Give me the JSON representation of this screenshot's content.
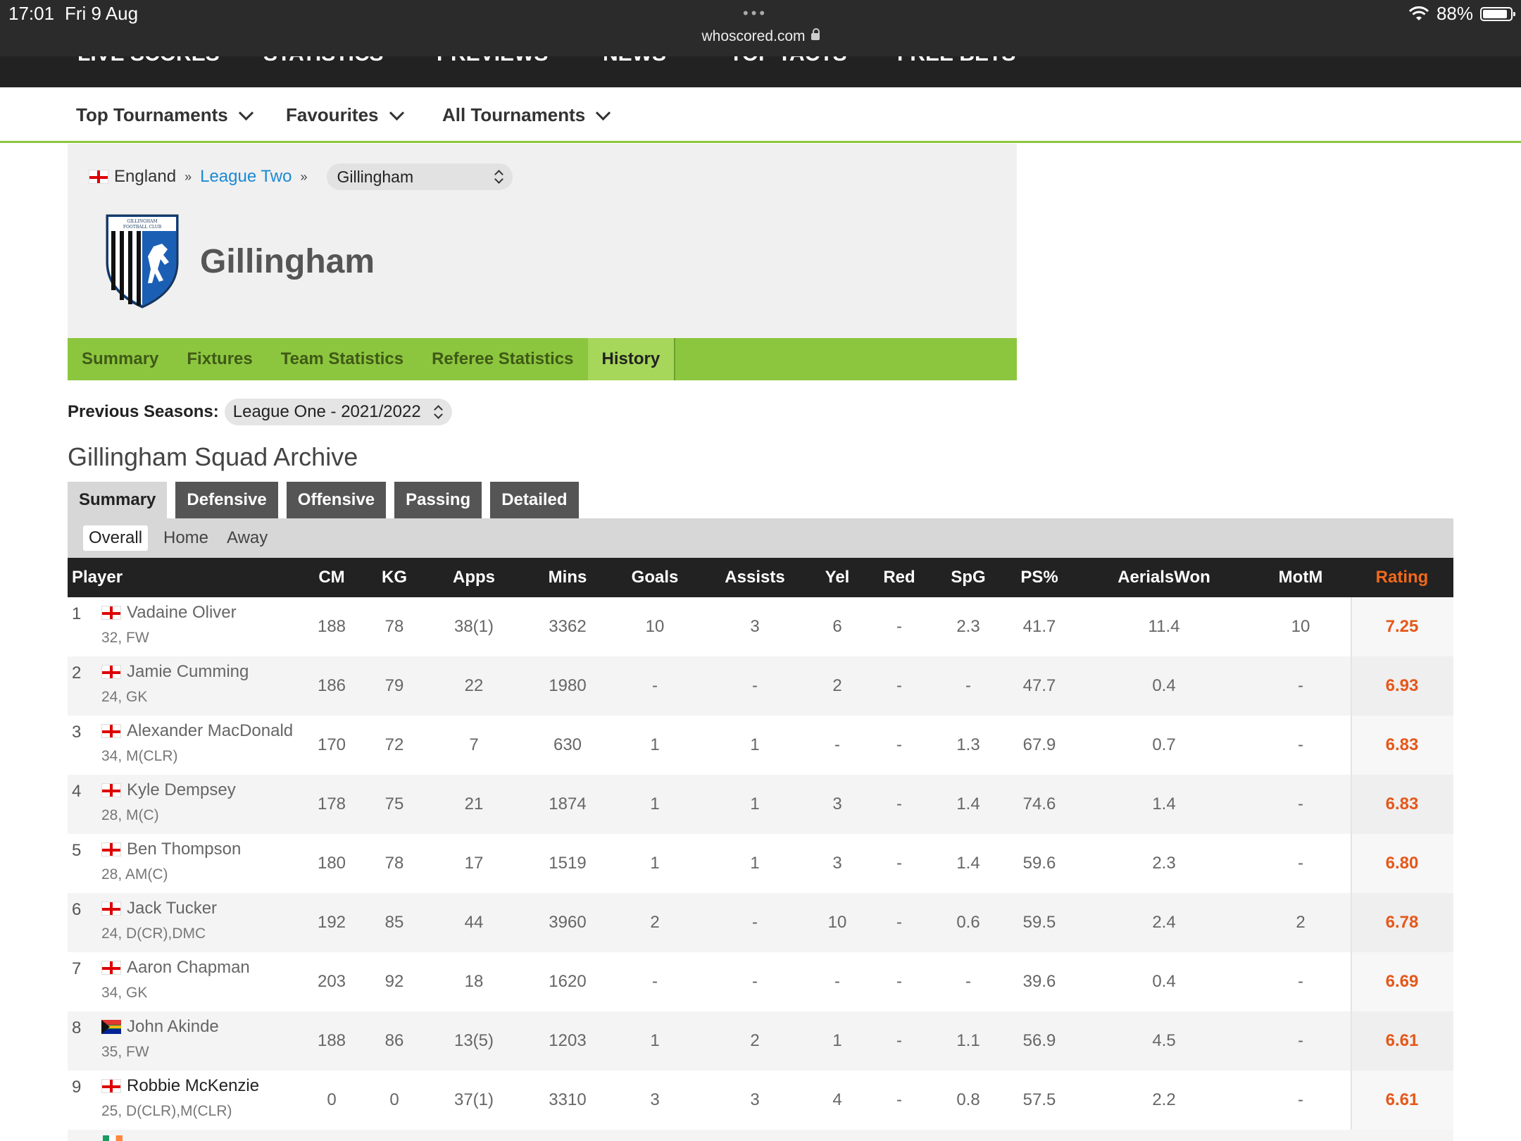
{
  "status_bar": {
    "time": "17:01",
    "date": "Fri 9 Aug",
    "url": "whoscored.com",
    "battery": "88%"
  },
  "site_nav": {
    "items": [
      "LIVE SCORES",
      "STATISTICS",
      "PREVIEWS",
      "NEWS",
      "TOP TACTS",
      "FREE BETS"
    ]
  },
  "tournament_bar": {
    "items": [
      "Top Tournaments",
      "Favourites",
      "All Tournaments"
    ]
  },
  "breadcrumb": {
    "country": "England",
    "league": "League Two",
    "team_select": "Gillingham"
  },
  "team": {
    "name": "Gillingham",
    "crest_text": "GILLINGHAM FOOTBALL CLUB"
  },
  "team_tabs": [
    "Summary",
    "Fixtures",
    "Team Statistics",
    "Referee Statistics",
    "History"
  ],
  "previous_seasons": {
    "label": "Previous Seasons:",
    "selected": "League One - 2021/2022"
  },
  "archive_title": "Gillingham Squad Archive",
  "stat_tabs": [
    "Summary",
    "Defensive",
    "Offensive",
    "Passing",
    "Detailed"
  ],
  "filters": [
    "Overall",
    "Home",
    "Away"
  ],
  "table": {
    "columns": [
      "Player",
      "CM",
      "KG",
      "Apps",
      "Mins",
      "Goals",
      "Assists",
      "Yel",
      "Red",
      "SpG",
      "PS%",
      "AerialsWon",
      "MotM",
      "Rating"
    ],
    "rows": [
      {
        "rank": "1",
        "name": "Vadaine Oliver",
        "info": "32, FW",
        "flag": "england",
        "cm": "188",
        "kg": "78",
        "apps": "38(1)",
        "mins": "3362",
        "goals": "10",
        "assists": "3",
        "yel": "6",
        "red": "-",
        "spg": "2.3",
        "ps": "41.7",
        "aerials": "11.4",
        "motm": "10",
        "rating": "7.25"
      },
      {
        "rank": "2",
        "name": "Jamie Cumming",
        "info": "24, GK",
        "flag": "england",
        "cm": "186",
        "kg": "79",
        "apps": "22",
        "mins": "1980",
        "goals": "-",
        "assists": "-",
        "yel": "2",
        "red": "-",
        "spg": "-",
        "ps": "47.7",
        "aerials": "0.4",
        "motm": "-",
        "rating": "6.93"
      },
      {
        "rank": "3",
        "name": "Alexander MacDonald",
        "info": "34, M(CLR)",
        "flag": "england",
        "cm": "170",
        "kg": "72",
        "apps": "7",
        "mins": "630",
        "goals": "1",
        "assists": "1",
        "yel": "-",
        "red": "-",
        "spg": "1.3",
        "ps": "67.9",
        "aerials": "0.7",
        "motm": "-",
        "rating": "6.83"
      },
      {
        "rank": "4",
        "name": "Kyle Dempsey",
        "info": "28, M(C)",
        "flag": "england",
        "cm": "178",
        "kg": "75",
        "apps": "21",
        "mins": "1874",
        "goals": "1",
        "assists": "1",
        "yel": "3",
        "red": "-",
        "spg": "1.4",
        "ps": "74.6",
        "aerials": "1.4",
        "motm": "-",
        "rating": "6.83"
      },
      {
        "rank": "5",
        "name": "Ben Thompson",
        "info": "28, AM(C)",
        "flag": "england",
        "cm": "180",
        "kg": "78",
        "apps": "17",
        "mins": "1519",
        "goals": "1",
        "assists": "1",
        "yel": "3",
        "red": "-",
        "spg": "1.4",
        "ps": "59.6",
        "aerials": "2.3",
        "motm": "-",
        "rating": "6.80"
      },
      {
        "rank": "6",
        "name": "Jack Tucker",
        "info": "24, D(CR),DMC",
        "flag": "england",
        "cm": "192",
        "kg": "85",
        "apps": "44",
        "mins": "3960",
        "goals": "2",
        "assists": "-",
        "yel": "10",
        "red": "-",
        "spg": "0.6",
        "ps": "59.5",
        "aerials": "2.4",
        "motm": "2",
        "rating": "6.78"
      },
      {
        "rank": "7",
        "name": "Aaron Chapman",
        "info": "34, GK",
        "flag": "england",
        "cm": "203",
        "kg": "92",
        "apps": "18",
        "mins": "1620",
        "goals": "-",
        "assists": "-",
        "yel": "-",
        "red": "-",
        "spg": "-",
        "ps": "39.6",
        "aerials": "0.4",
        "motm": "-",
        "rating": "6.69"
      },
      {
        "rank": "8",
        "name": "John Akinde",
        "info": "35, FW",
        "flag": "south-africa",
        "cm": "188",
        "kg": "86",
        "apps": "13(5)",
        "mins": "1203",
        "goals": "1",
        "assists": "2",
        "yel": "1",
        "red": "-",
        "spg": "1.1",
        "ps": "56.9",
        "aerials": "4.5",
        "motm": "-",
        "rating": "6.61"
      },
      {
        "rank": "9",
        "name": "Robbie McKenzie",
        "info": "25, D(CLR),M(CLR)",
        "flag": "england",
        "cm": "0",
        "kg": "0",
        "apps": "37(1)",
        "mins": "3310",
        "goals": "3",
        "assists": "3",
        "yel": "4",
        "red": "-",
        "spg": "0.8",
        "ps": "57.5",
        "aerials": "2.2",
        "motm": "-",
        "rating": "6.61"
      }
    ]
  },
  "colors": {
    "green_bar": "#8cc63f",
    "rating_orange": "#e5581a",
    "link_blue": "#1a8ad4",
    "dark_header": "#222222"
  }
}
